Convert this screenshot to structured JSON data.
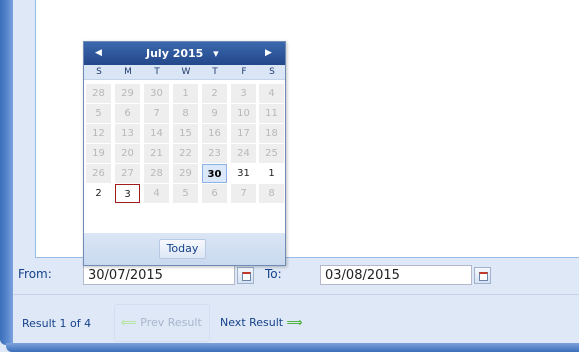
{
  "form": {
    "from_label": "From:",
    "from_value": "30/07/2015",
    "to_label": "To:",
    "to_value": "03/08/2015"
  },
  "results": {
    "summary": "Result 1 of 4",
    "prev_label": "Prev Result",
    "next_label": "Next Result",
    "prev_arrow": "⟸",
    "next_arrow": "⟹"
  },
  "datepicker": {
    "month_label": "July 2015",
    "prev_glyph": "◀",
    "next_glyph": "▶",
    "menu_glyph": "▾",
    "weekdays": [
      "S",
      "M",
      "T",
      "W",
      "T",
      "F",
      "S"
    ],
    "weeks": [
      [
        "28",
        "29",
        "30",
        "1",
        "2",
        "3",
        "4"
      ],
      [
        "5",
        "6",
        "7",
        "8",
        "9",
        "10",
        "11"
      ],
      [
        "12",
        "13",
        "14",
        "15",
        "16",
        "17",
        "18"
      ],
      [
        "19",
        "20",
        "21",
        "22",
        "23",
        "24",
        "25"
      ],
      [
        "26",
        "27",
        "28",
        "29",
        "30",
        "31",
        "1"
      ],
      [
        "2",
        "3",
        "4",
        "5",
        "6",
        "7",
        "8"
      ]
    ],
    "today_label": "Today"
  },
  "colors": {
    "header": "#23478a",
    "accent": "#15428b",
    "today_border": "#a11c1c"
  }
}
